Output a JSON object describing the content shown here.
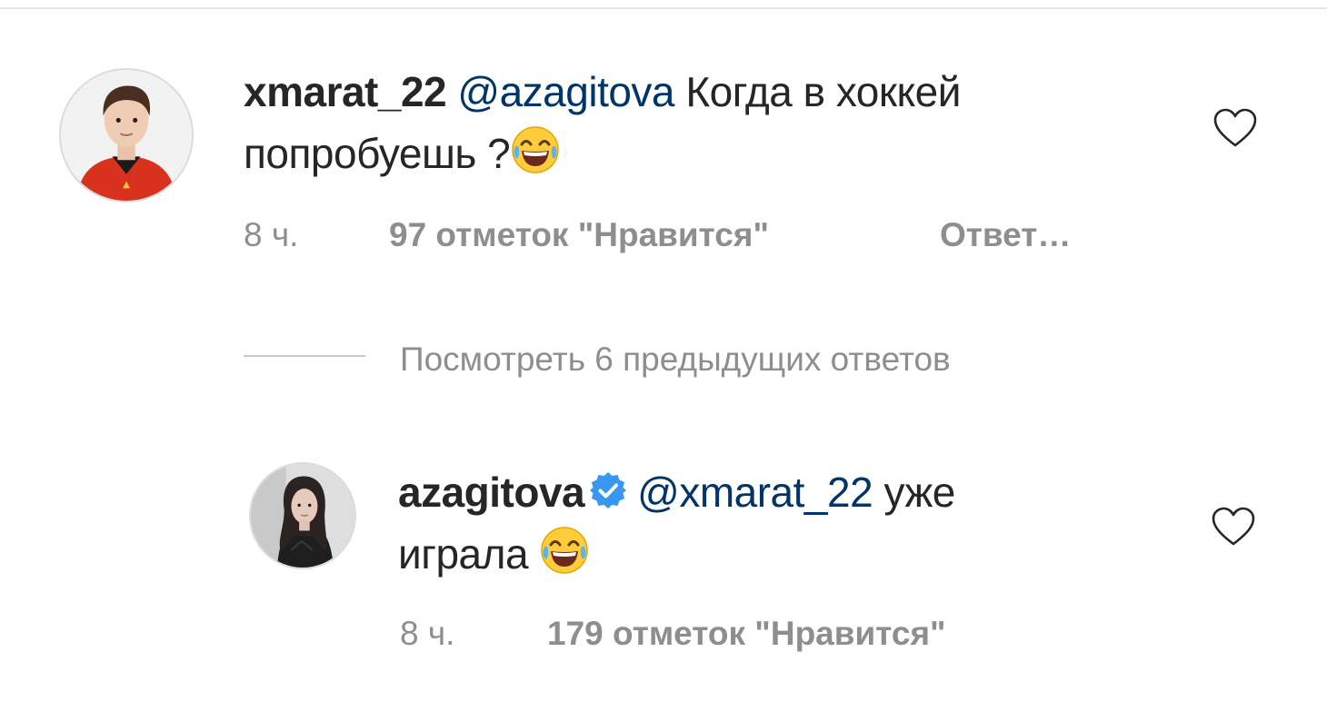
{
  "comments": [
    {
      "username": "xmarat_22",
      "avatar_icon": "user-avatar-red-jersey",
      "mention": "@azagitova",
      "text_line1": "Когда в хоккей",
      "text_line2": "попробуешь ?",
      "emoji": "face-with-tears-of-joy",
      "time": "8 ч.",
      "likes": "97 отметок \"Нравится\"",
      "reply": "Ответ…",
      "like_icon": "heart-outline-icon"
    },
    {
      "username": "azagitova",
      "avatar_icon": "user-avatar-dark-hair",
      "verified_icon": "verified-badge-icon",
      "mention": "@xmarat_22",
      "text_line1": "уже",
      "text_line2": "играла",
      "emoji": "face-with-tears-of-joy",
      "time": "8 ч.",
      "likes": "179 отметок \"Нравится\"",
      "like_icon": "heart-outline-icon"
    }
  ],
  "view_replies_label": "Посмотреть 6 предыдущих ответов",
  "colors": {
    "text": "#262626",
    "mention": "#003569",
    "muted": "#8e8e8e",
    "verified": "#3897f0"
  }
}
